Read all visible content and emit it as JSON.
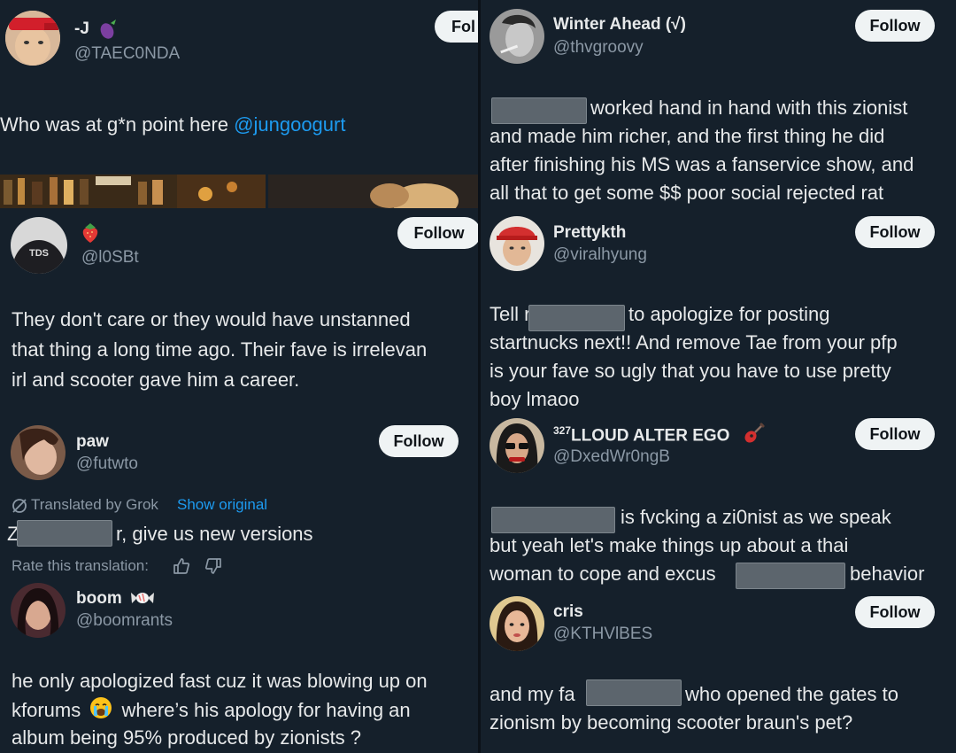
{
  "left": {
    "post1": {
      "name": "-J",
      "handle": "@TAEC0NDA",
      "follow": "Fol",
      "text_prefix": "Who was at g*n point here ",
      "mention": "@jungoogurt",
      "avatar_icon": "person-red-bandana-avatar",
      "name_emoji_icon": "eggplant-emoji-icon"
    },
    "post2": {
      "handle": "@l0SBt",
      "follow": "Follow",
      "name_emoji_icon": "strawberry-emoji-icon",
      "avatar_label": "TDS",
      "lines": [
        "They don't care or they would have unstanned",
        "that thing a long time ago. Their fave is irrelevan",
        "irl and scooter gave him a career."
      ]
    },
    "post3": {
      "name": "paw",
      "handle": "@futwto",
      "follow": "Follow",
      "translated_label": "Translated by Grok",
      "show_original": "Show original",
      "text_start": "Z",
      "text_end": "r, give us new versions",
      "rate_label": "Rate this translation:"
    },
    "post4": {
      "name": "boom",
      "handle": "@boomrants",
      "name_emoji_icon": "candy-emoji-icon",
      "line1": "he only apologized fast cuz it was blowing up on",
      "line2_a": "kforums",
      "line2_b": "where’s his apology for having an",
      "line3": "album being 95% produced by zionists ?",
      "inline_emoji_icon": "crying-face-emoji-icon"
    }
  },
  "right": {
    "post1": {
      "name": "Winter Ahead (√)",
      "handle": "@thvgroovy",
      "follow": "Follow",
      "line1": "worked hand in hand with this zionist",
      "line2": "and made him richer, and the first thing he did",
      "line3": "after finishing his MS was a fanservice show, and",
      "line4": "all that to get some $$ poor social rejected rat"
    },
    "post2": {
      "name": "Prettykth",
      "handle": "@viralhyung",
      "follow": "Follow",
      "line1_a": "Tell r",
      "line1_b": "to apologize for posting",
      "line2": "startnucks next!! And remove Tae from your pfp",
      "line3": "is your fave so ugly that  you have to use pretty",
      "line4": "boy lmaoo"
    },
    "post3": {
      "name_sup": "327",
      "name": "LLOUD ALTER EGO",
      "handle": "@DxedWr0ngB",
      "follow": "Follow",
      "name_emoji_icon": "guitar-emoji-icon",
      "line1": "is fvcking a zi0nist as we speak",
      "line2": "but yeah let's make things up about a thai",
      "line3_a": "woman to cope and excus",
      "line3_b": "behavior"
    },
    "post4": {
      "name": "cris",
      "handle": "@KTHVlBES",
      "follow": "Follow",
      "line1_a": "and my fa",
      "line1_b": "who opened the gates to",
      "line2": "zionism by becoming scooter braun's pet?"
    }
  },
  "colors": {
    "background": "#15202b",
    "text": "#e7e9ea",
    "secondary": "#8b98a5",
    "link": "#1d9bf0",
    "button": "#eff3f4",
    "redaction": "#5c656d"
  }
}
